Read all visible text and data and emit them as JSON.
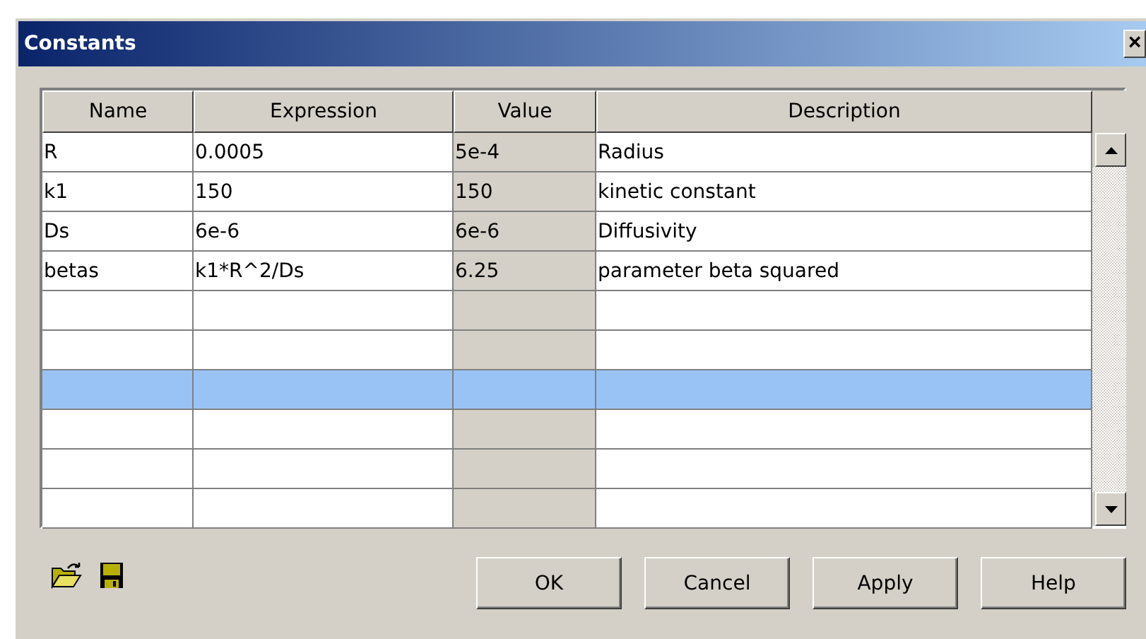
{
  "window": {
    "title": "Constants",
    "close": "×"
  },
  "table": {
    "columns": [
      "Name",
      "Expression",
      "Value",
      "Description"
    ],
    "rows": [
      {
        "name": "R",
        "expression": "0.0005",
        "value": "5e-4",
        "description": "Radius",
        "selected": false
      },
      {
        "name": "k1",
        "expression": "150",
        "value": "150",
        "description": "kinetic constant",
        "selected": false
      },
      {
        "name": "Ds",
        "expression": "6e-6",
        "value": "6e-6",
        "description": "Diffusivity",
        "selected": false
      },
      {
        "name": "betas",
        "expression": "k1*R^2/Ds",
        "value": "6.25",
        "description": "parameter beta squared",
        "selected": false
      },
      {
        "selected": false
      },
      {
        "selected": false
      },
      {
        "selected": true
      },
      {
        "selected": false
      },
      {
        "selected": false
      },
      {
        "selected": false
      }
    ]
  },
  "buttons": [
    "OK",
    "Cancel",
    "Apply",
    "Help"
  ]
}
